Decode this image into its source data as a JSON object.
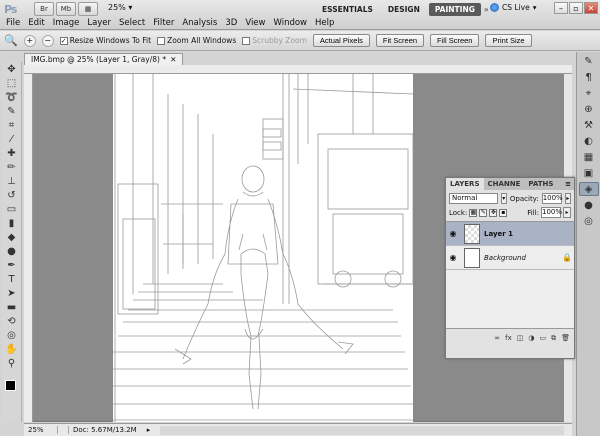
{
  "app": {
    "logo": "Ps",
    "zoom": "25%",
    "menus": [
      "File",
      "Edit",
      "Image",
      "Layer",
      "Select",
      "Filter",
      "Analysis",
      "3D",
      "View",
      "Window",
      "Help"
    ],
    "workspaces": [
      "ESSENTIALS",
      "DESIGN",
      "PAINTING"
    ],
    "active_workspace": "PAINTING",
    "cs_live": "CS Live",
    "app_icons": [
      "Br",
      "Mb"
    ]
  },
  "options": {
    "resize_windows": "Resize Windows To Fit",
    "zoom_all": "Zoom All Windows",
    "scrubby": "Scrubby Zoom",
    "actual_pixels": "Actual Pixels",
    "fit_screen": "Fit Screen",
    "fill_screen": "Fill Screen",
    "print_size": "Print Size"
  },
  "document": {
    "tab_title": "IMG.bmp @ 25% (Layer 1, Gray/8) *",
    "zoom": "25%",
    "doc_info": "Doc: 5.67M/13.2M"
  },
  "layers_panel": {
    "tabs": [
      "LAYERS",
      "CHANNE",
      "PATHS"
    ],
    "blend_mode": "Normal",
    "opacity_label": "Opacity:",
    "opacity": "100%",
    "lock_label": "Lock:",
    "fill_label": "Fill:",
    "fill": "100%",
    "layers": [
      {
        "name": "Layer 1",
        "selected": true
      },
      {
        "name": "Background",
        "selected": false
      }
    ]
  }
}
